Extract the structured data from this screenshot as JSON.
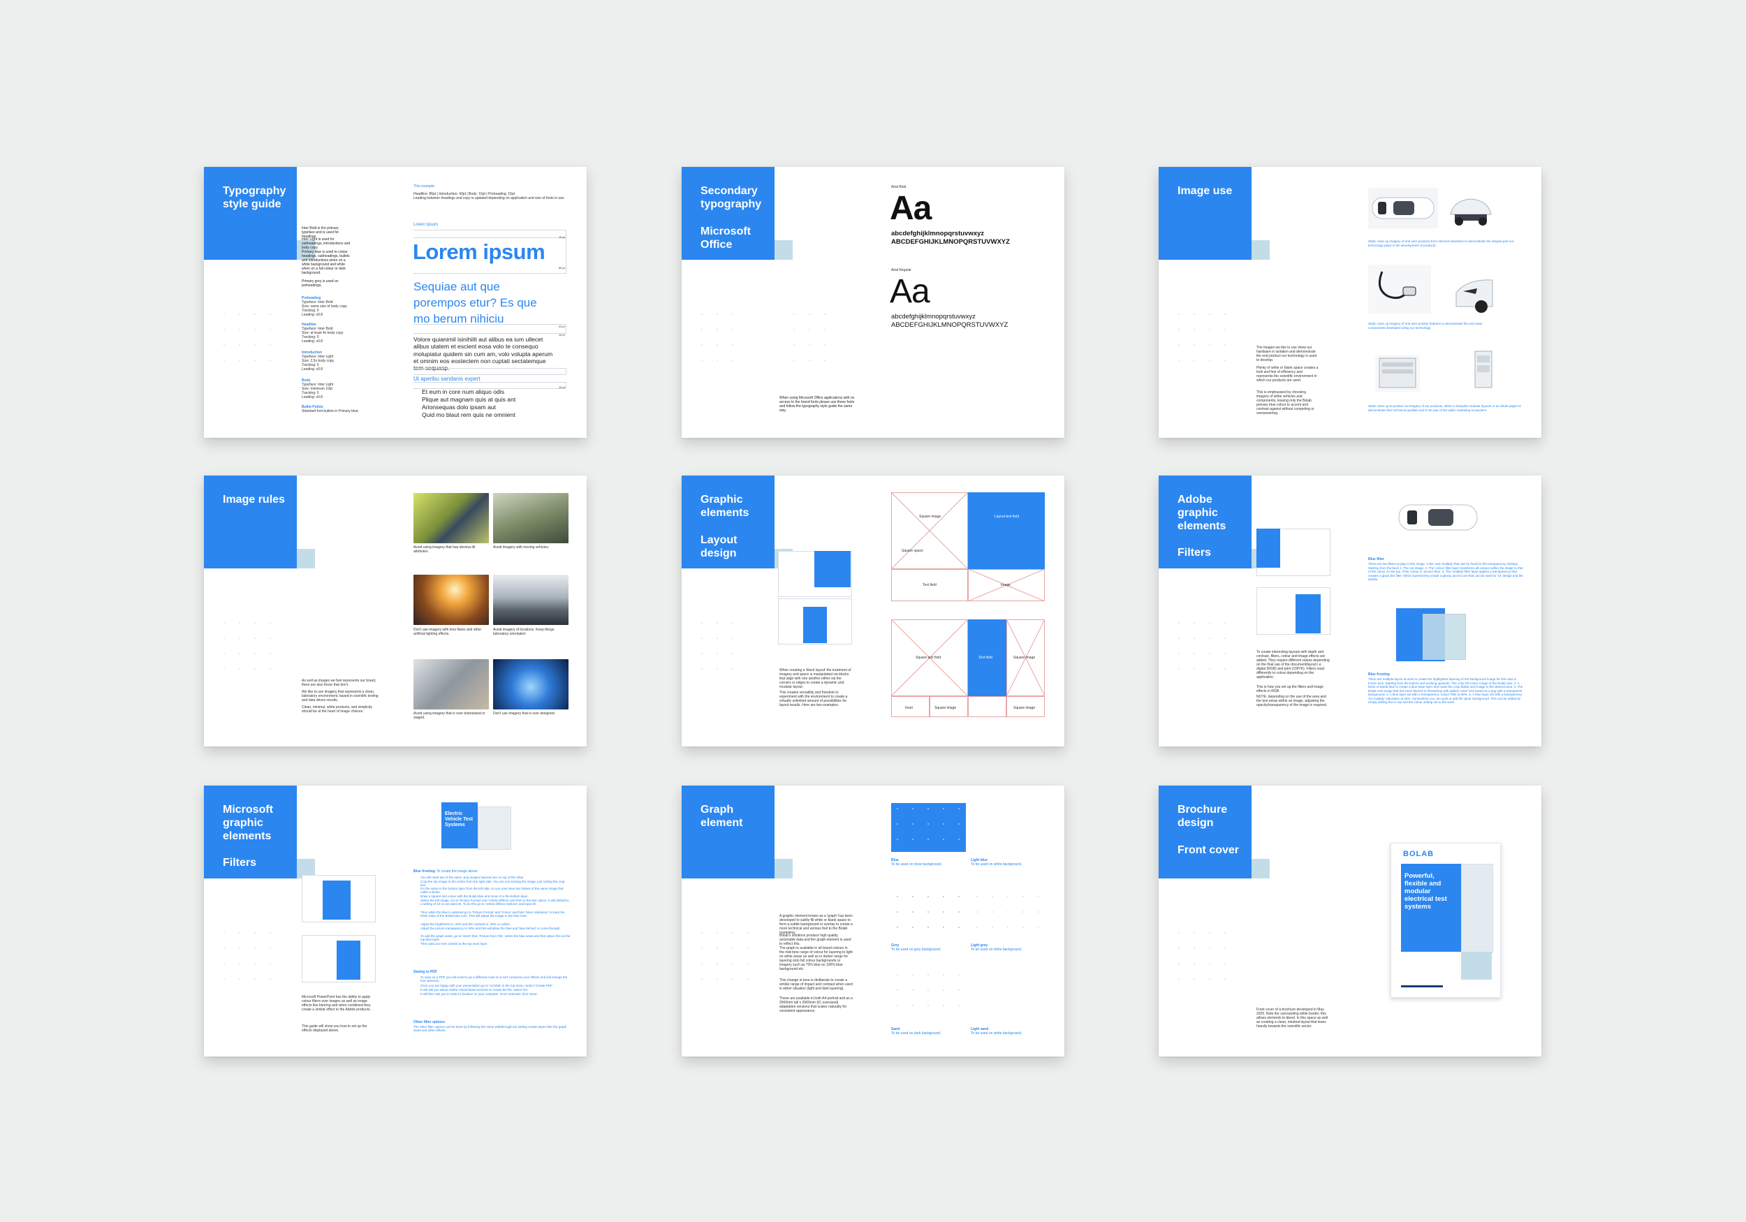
{
  "colors": {
    "brand_blue": "#2b86f0",
    "accent_light": "#c3dde8",
    "background": "#ecefed"
  },
  "pages": {
    "p1": {
      "title": "Typography style guide",
      "left_text": [
        "Inter Bold is the primary typeface and is used for headings.",
        "Inter Light is used for subheadings, introductions and body copy.",
        "Primary blue is used to colour headings, subheadings, bullets and introductions when on a white background and white when on a full colour or dark background.",
        "Primary grey is used on preheadings."
      ],
      "specs": [
        {
          "name": "Preheading",
          "lines": [
            "Typeface: Inter Bold",
            "Size: same size of body copy",
            "Tracking: 0",
            "Leading: x0.8"
          ]
        },
        {
          "name": "Headline",
          "lines": [
            "Typeface: Inter Bold",
            "Size: at least 4x body copy",
            "Tracking: 0",
            "Leading: x0.8"
          ]
        },
        {
          "name": "Introduction",
          "lines": [
            "Typeface: Inter Light",
            "Size: 2.5x body copy",
            "Tracking: 0",
            "Leading: x0.8"
          ]
        },
        {
          "name": "Body",
          "lines": [
            "Typeface: Inter Light",
            "Size: minimum 10pt",
            "Tracking: 0",
            "Leading: x0.8"
          ]
        }
      ],
      "bullet_points_label": "Bullet Points",
      "bullet_points_text": "Standard font bullets in Primary blue.",
      "example_label": "This example:",
      "example_spec": "Headline: 86pt | Introduction: 43pt | Body: 15pt | Preheading: 15pt",
      "example_note": "Leading between headings and copy is updated depending on application and size of fonts in use.",
      "preheading": "Lorem Ipsum",
      "headline": "Lorem ipsum",
      "intro": "Sequiae aut que porempos etur? Es que mo berum nihiciu",
      "body": "Volore quianimil isinihilit aut alibus ea ium ullecet alibus utatem et escient eosa volo te consequo molupiatur quidem sin cum am, volo volupta aperum et omnim eos eostectem non cuptati sectatemque tem sequasp.",
      "subhead": "Ut aperibu sandanis expert",
      "bullets": [
        "Et eum in core num aliquo odis",
        "Plique aut magnam quis at quis ant",
        "Arionsequas dolo ipsam aut",
        "Quid mo blaut rem quis ne omnient"
      ],
      "measures": [
        "15 pt",
        "86 pt",
        "43 pt",
        "15 pt",
        "15 pt"
      ]
    },
    "p2": {
      "title": "Secondary typography",
      "subtitle": "Microsoft Office",
      "fonts": [
        {
          "label": "Arial Bold",
          "sample": "Aa",
          "lower": "abcdefghijklmnopqrstuvwxyz",
          "upper": "ABCDEFGHIJKLMNOPQRSTUVWXYZ"
        },
        {
          "label": "Arial Regular",
          "sample": "Aa",
          "lower": "abcdefghijklmnopqrstuvwxyz",
          "upper": "ABCDEFGHIJKLMNOPQRSTUVWXYZ"
        }
      ],
      "note": "When using Microsoft Office applications with no access to the brand fonts please use these fonts and follow the typography style guide the same way."
    },
    "p3": {
      "title": "Image use",
      "captions": [
        "Static close up imagery of end user products from relevant industries to demonstrate the integral part our technology plays in the development of products.",
        "Static close up imagery of end user product features to demonstrate the end value components developed using our technology.",
        "Static close up to product cut imagery of our products, either in bespoke modular layouts or as whole pages to demonstrate their technical qualities and to be part of the wider marketing ecosystem."
      ],
      "body": [
        "The images we like to use show our hardware in isolation and demonstrate the end product our technology is used to develop.",
        "Plenty of white or blank space creates a look and feel of efficiency and represents the scientific environment in which our products are used.",
        "This is emphasised by choosing imagery of white vehicles and components, leaving only the Bolab primary blue colour to accent and contrast against without competing or overpowering."
      ]
    },
    "p4": {
      "title": "Image rules",
      "captions": [
        "Avoid using imagery that has obvious AI attributes.",
        "Avoid imagery with moving vehicles.",
        "Don't use imagery with lens flares and other artificial lighting effects.",
        "Avoid imagery of locations. Keep things laboratory orientated.",
        "Avoid using imagery that is over dramatised or staged.",
        "Don't use imagery that is over designed."
      ],
      "body": [
        "As well as images we feel represents our brand, there are also those that don't.",
        "We like to use imagery that represents a clean, laboratory environment, based in scientific testing and data driven results.",
        "Clean, minimal, white products, and simplicity should be at the heart of image choices."
      ]
    },
    "p5": {
      "title": "Graphic elements",
      "subtitle": "Layout design",
      "grid_labels": [
        "Square image",
        "Layout text field",
        "Square space",
        "Text field",
        "Image",
        "Square text field",
        "Text field",
        "Square image",
        "Inset",
        "Square image",
        "Square image"
      ],
      "body": [
        "When creating a 'block layout' the treatment of imagery and space is manipulated via blocks that align with one another either via the corners or edges to create a dynamic and modular layout.",
        "This creates versatility and freedom to experiment with the environment to create a virtually unlimited amount of possibilities for layout results. Here are two examples."
      ]
    },
    "p6": {
      "title": "Adobe graphic elements",
      "subtitle": "Filters",
      "headings": [
        "Blue filter",
        "Blue frosting"
      ],
      "texts": [
        "There are two filters at play in this image: 'color' and 'multiply' that can be found in the transparency settings. Starting from the back 1. The car image, 2. The 'colour' filter layer transforms all colours within the image to that of the colour on the top. If the 'colour is 'accent' blue, 3. The 'multiply' filter layer applies a transparency that creates a glass like filter. When layered they create a glassy accent one that can be used for 'UI' design and the quality.",
        "There are multiple layers at work to create the highlighted layering of the background image for this case a frozen look. Starting from the bottom and working upwards: The crisp full colour image of the Bolab rack, 2. A block of Bolab blue to create a blue base layer and mask the crisp Bolab rack image to the desired area. 3. The Bolab rack image that has been blurred in Photoshop with added 'noise' and saved as a png with a transparent background. 4. A blue layer set with a transparency 'colour' filter at 80%. 5. A blue layer set with a transparency 'lux multiply' saturation at 20%. Somewhere you can work to add the 'glow' background. This can be added by simply adding this in top and the colour setting set to the work."
      ],
      "body": [
        "To create interesting layouts with depth and contrast, filters, colour and image effects are added. They require different values depending on the final use of the document/layout i.e. digital (RGB) and print (CMYK). Filters react differently to colour depending on the application.",
        "This is how you set up the filters and image effects in RGB.",
        "NOTE: depending on the use of the area and the text areas within an image, adjusting the opacity/transparency of the image is required."
      ]
    },
    "p7": {
      "title": "Microsoft graphic elements",
      "subtitle": "Filters",
      "mock_title": "Electric Vehicle Test Systems",
      "headings": [
        "Blue frosting",
        "Saving to PDF",
        "Other filter options"
      ],
      "heading_note": "- To create the image above",
      "steps": [
        "You will need two of the same .png images layered one on top of the other.",
        "Crop the top image to the centre from the right side. You are not resizing the image, just cutting the crop box.",
        "Go the same to the bottom layer from the left side, so you now have two halves of the same image that make a whole.",
        "Draw a square text colour with the Bolab blue and move it to the bottom layer.",
        "Select the left image, Go to 'Picture Format' and 'Artistic Effects' and then to the blur option. It will default to a setting of 10 so we want 20. To do this go to 'Artistic Effects Options' and input 20.",
        "Then while the blue is selected go to 'Picture Format' and 'Colour' and then 'More Variations' to input the RGB value of the Bolab blue tone. This will adjust the image to the blue tone.",
        "Adjust the brightness to -15% and the contrast to -30% to soften.",
        "Adjust the picture transparency to 40% and this will allow the blue and 'blue behind' to come through.",
        "To add the graph asset, go to 'Insert' then 'Picture from File', select the blue asset and then place this as the top blue layer.",
        "Then add your text content to the top most layer."
      ],
      "pdf_text": [
        "To save as a PDF you will need to go a different route so it isn't compress your effects and will change the font selection.",
        "Once you are happy with your presentation go to 'Acrobat' in the top menu. Select 'Create PDF'.",
        "It will ask you about Adobe Cloud based services to create the file, select 'No'.",
        "It will then ask you to select a location on your computer. Once selected, click 'Save'."
      ],
      "other_text": "The other filter options can be done by following the same walkthrough but setting certain layers like the graph asset and other effects.",
      "body": [
        "Microsoft PowerPoint has the ability to apply colour filters over images as well as image effects like blurring and when combined they create a similar effect to the Adobe products.",
        "This guide will show you how to set up the effects displayed above."
      ]
    },
    "p8": {
      "title": "Graph element",
      "labels": [
        [
          "Blue",
          "To be used on clear background."
        ],
        [
          "Light blue",
          "To be used on white background."
        ],
        [
          "Grey",
          "To be used on grey background."
        ],
        [
          "Light grey",
          "To be used on white background."
        ],
        [
          "Sand",
          "To be used on dark background."
        ],
        [
          "Light sand",
          "To be used on white background."
        ]
      ],
      "body": [
        "A graphic element known as a 'graph' has been developed to subtly fill white or blank space to form a subtle background or overlay to create a more technical and serious feel to the Bolab marketing.",
        "Bolab's solutions produce high quality, actionable data and the graph element is used to reflect this.",
        "The graph is available in all brand colours in the mid-tone range of colour for layering to light on white areas as well as in darker range for layering onto full colour backgrounds or imagery such as 70% blue on 100% blue background etc.",
        "This change in tone is deliberate to create a similar range of impact and contrast when used in either situation (light and dark layering).",
        "These are available in both A4 portrait and as a 2560mm tall x 2960mm (IC oversized) adaptation versions that scales naturally for consistent appearance."
      ]
    },
    "p9": {
      "title": "Brochure design",
      "subtitle": "Front cover",
      "logo": "BOLAB",
      "cover_heading": "Powerful, flexible and modular electrical test systems",
      "body": "Front cover of a brochure developed in May 2025. Note the surrounding white border, this allows elements to bleed. In this space as well as creating a clean, minimal layout that leans heavily towards the scientific sector."
    }
  }
}
